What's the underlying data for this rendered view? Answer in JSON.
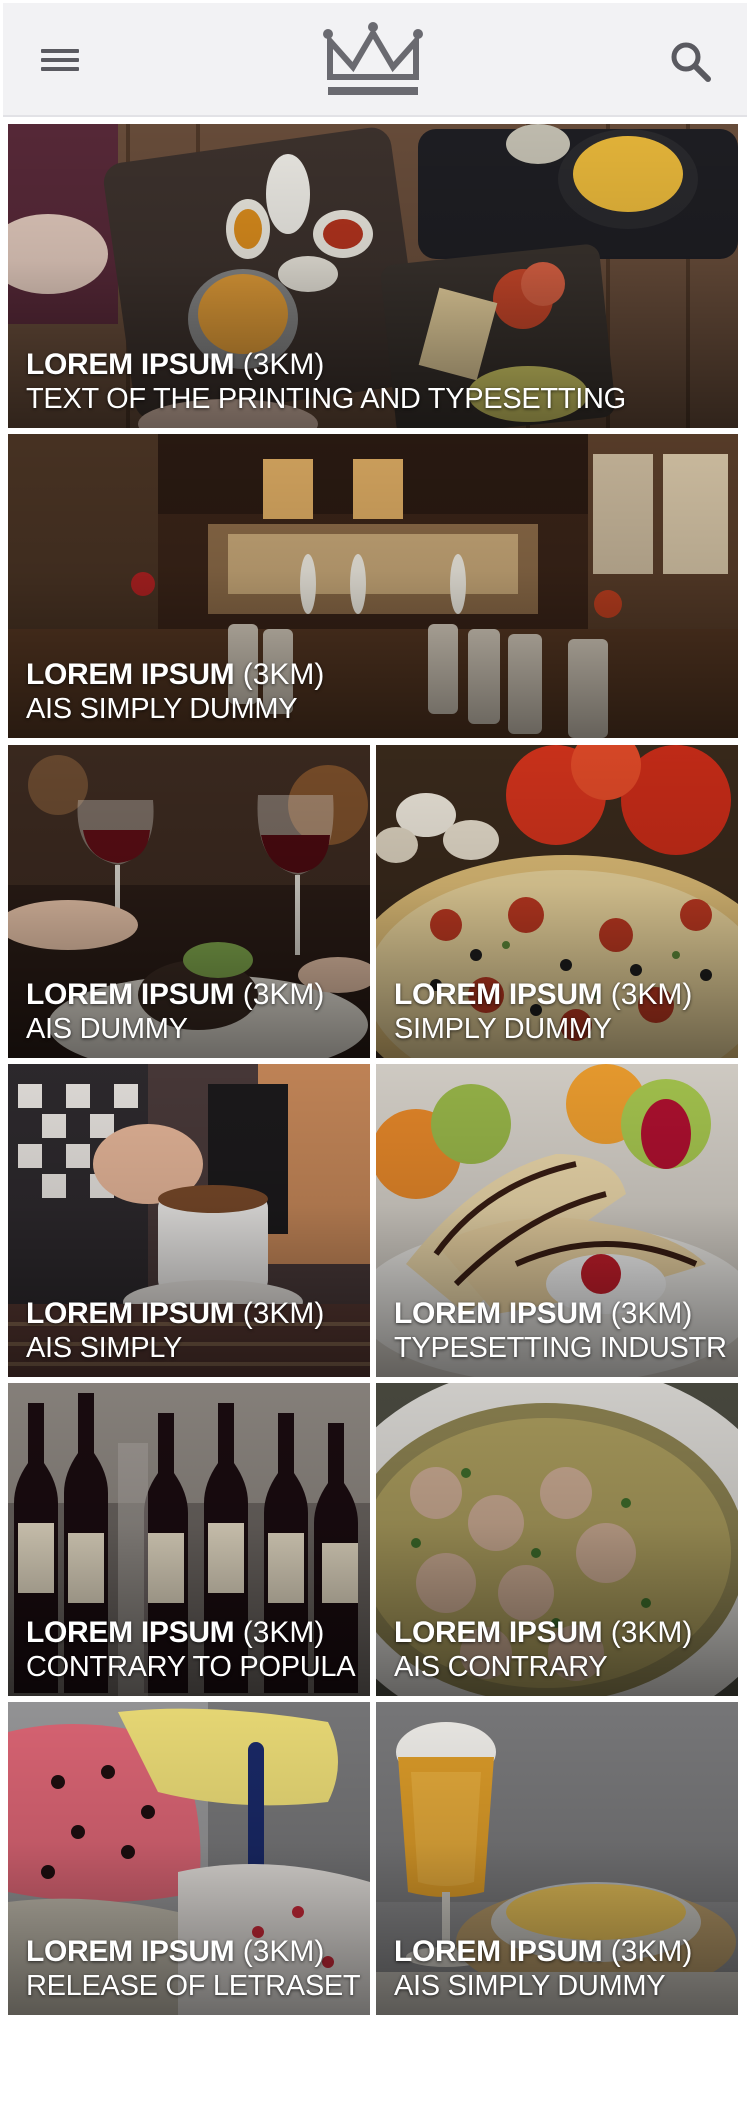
{
  "header": {
    "menu_icon": "hamburger-menu-icon",
    "logo_icon": "crown-logo-icon",
    "search_icon": "search-icon"
  },
  "tiles": [
    {
      "name": "LOREM IPSUM",
      "distance": "(3KM)",
      "subtitle": "TEXT OF THE PRINTING AND TYPESETTING",
      "scene": "food platter on wooden table"
    },
    {
      "name": "LOREM IPSUM",
      "distance": "(3KM)",
      "subtitle": "AIS SIMPLY DUMMY",
      "scene": "restaurant interior with open kitchen"
    },
    {
      "name": "LOREM IPSUM",
      "distance": "(3KM)",
      "subtitle": "AIS DUMMY",
      "scene": "red wine glasses and dinner"
    },
    {
      "name": "LOREM IPSUM",
      "distance": "(3KM)",
      "subtitle": "SIMPLY DUMMY",
      "scene": "pizza with tomatoes and mushrooms"
    },
    {
      "name": "LOREM IPSUM",
      "distance": "(3KM)",
      "subtitle": "AIS SIMPLY",
      "scene": "coffee cup"
    },
    {
      "name": "LOREM IPSUM",
      "distance": "(3KM)",
      "subtitle": "TYPESETTING INDUSTR",
      "scene": "crepe dessert with fruit"
    },
    {
      "name": "LOREM IPSUM",
      "distance": "(3KM)",
      "subtitle": "CONTRARY TO POPULA",
      "scene": "wine bottles"
    },
    {
      "name": "LOREM IPSUM",
      "distance": "(3KM)",
      "subtitle": "AIS CONTRARY",
      "scene": "soup with meatballs"
    },
    {
      "name": "LOREM IPSUM",
      "distance": "(3KM)",
      "subtitle": "RELEASE OF LETRASET",
      "scene": "gelato display"
    },
    {
      "name": "LOREM IPSUM",
      "distance": "(3KM)",
      "subtitle": "AIS SIMPLY DUMMY",
      "scene": "glass of beer and chips"
    }
  ]
}
